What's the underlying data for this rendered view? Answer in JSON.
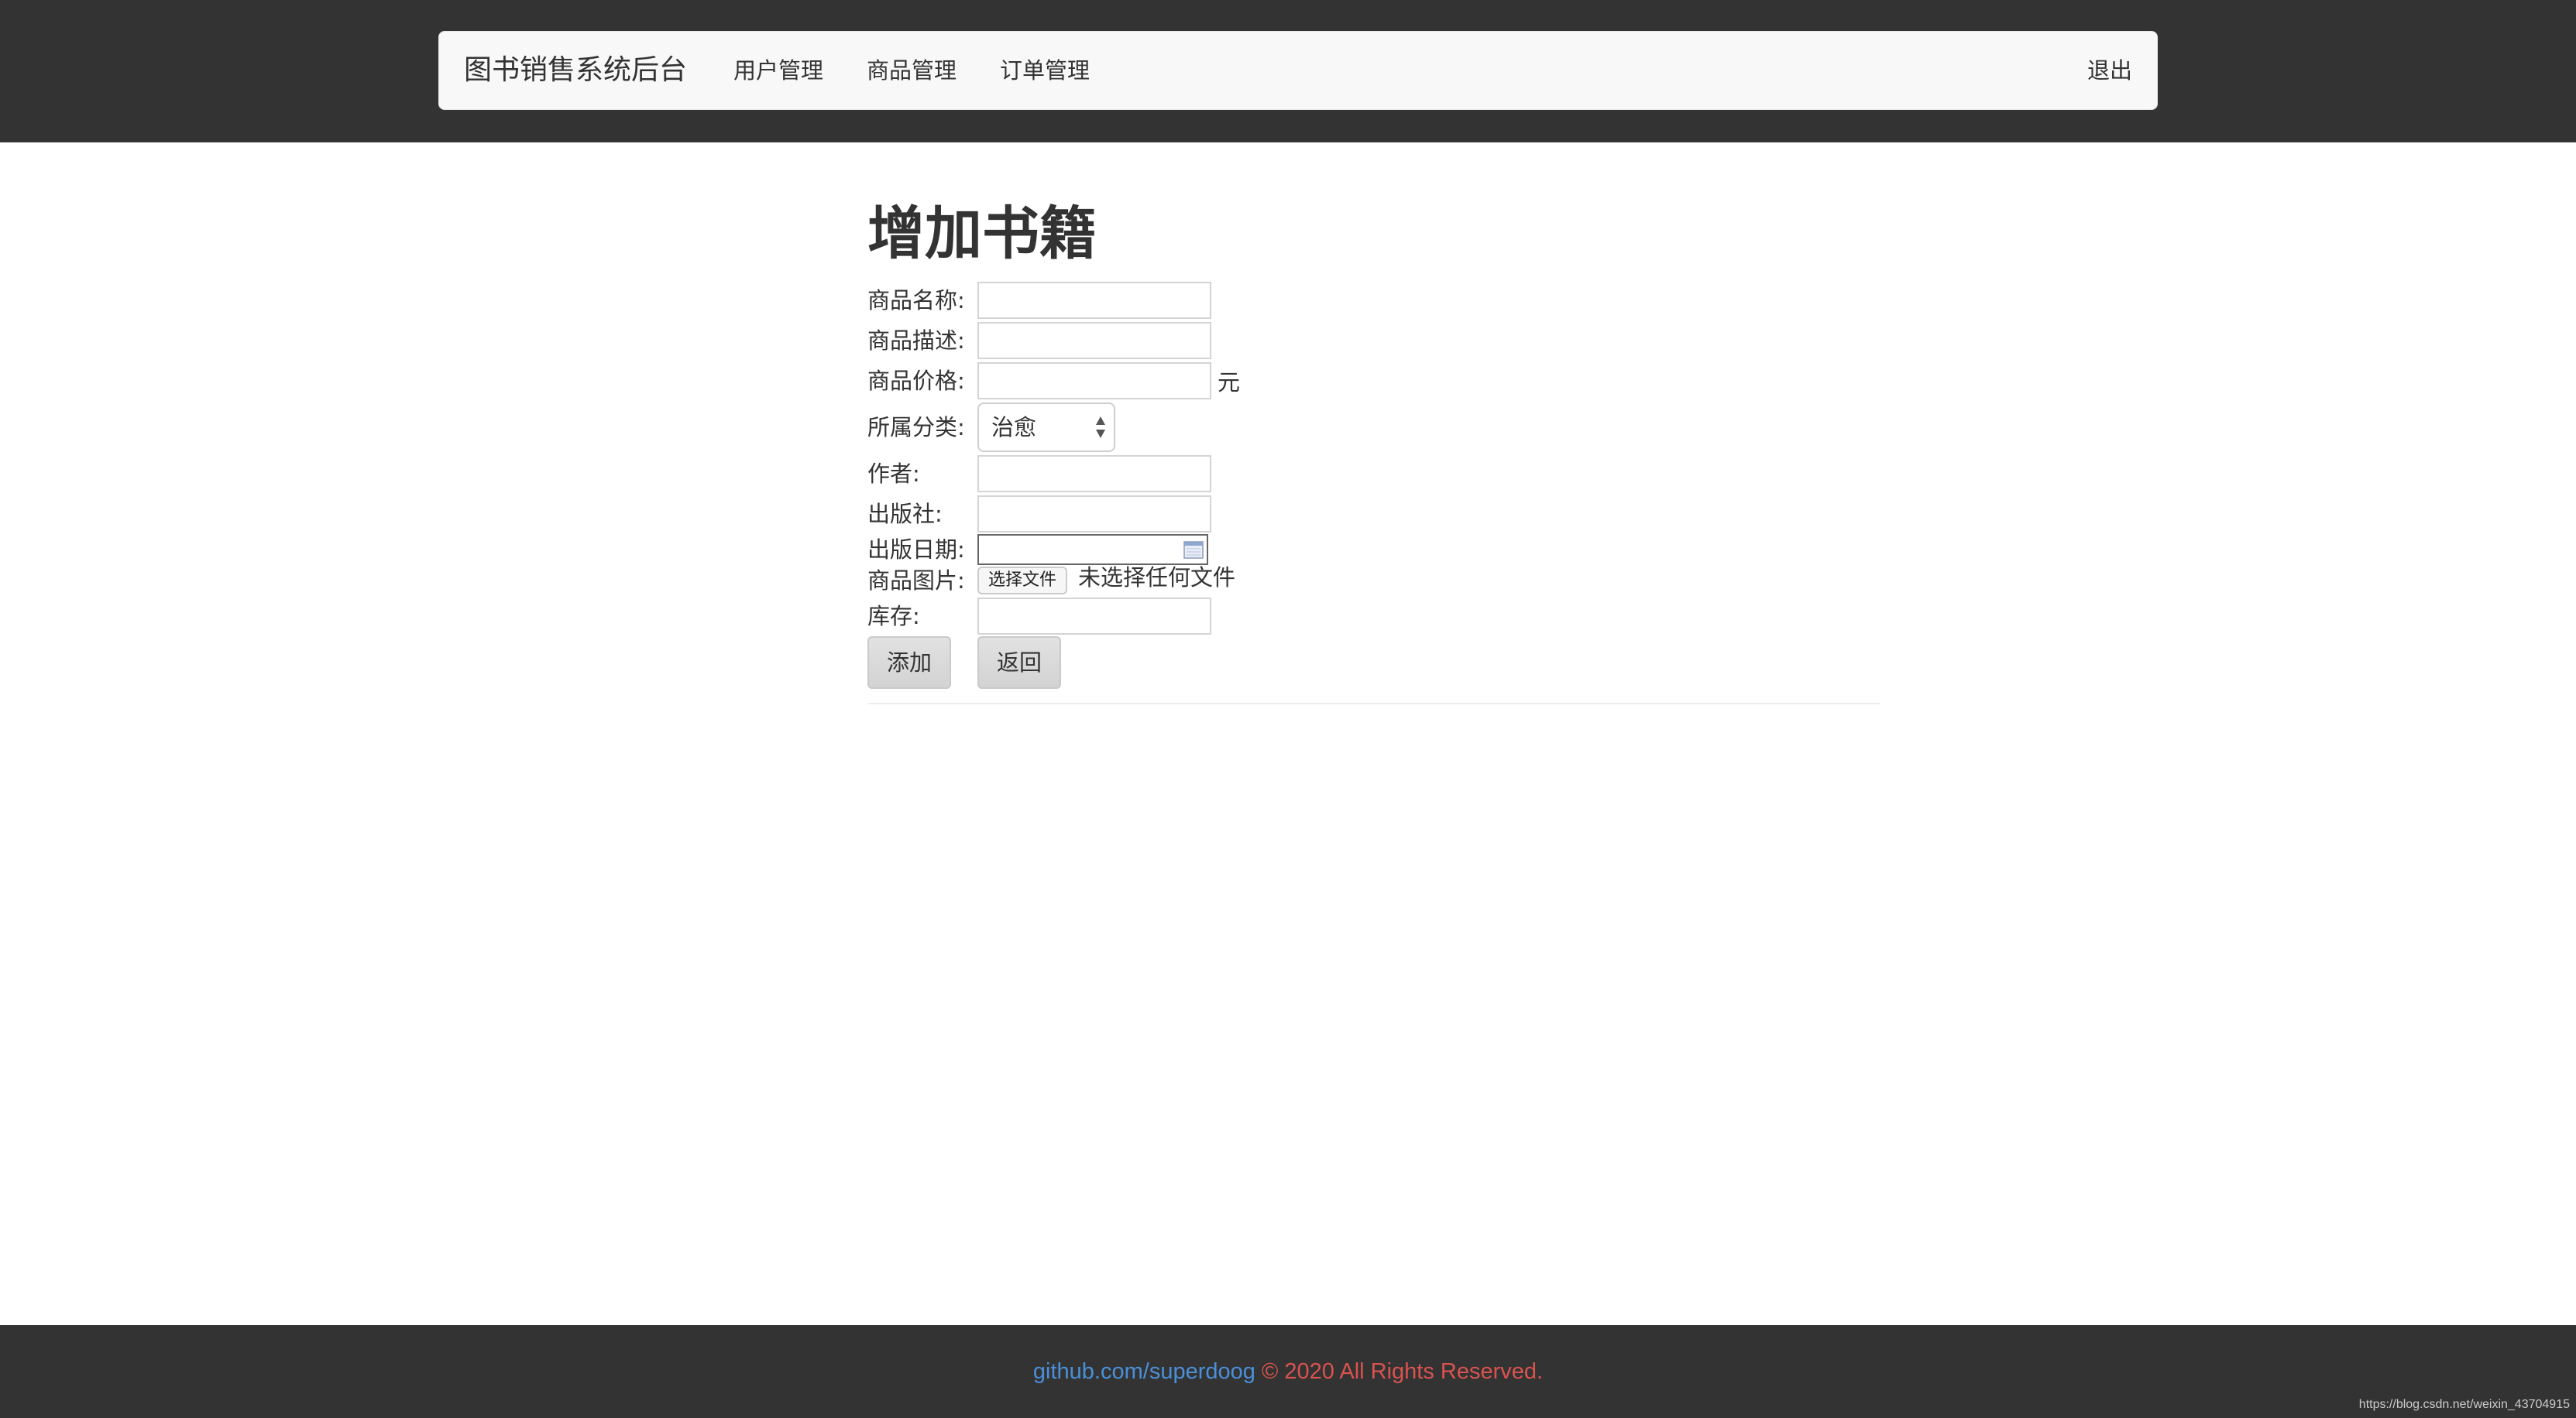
{
  "navbar": {
    "brand": "图书销售系统后台",
    "links": [
      "用户管理",
      "商品管理",
      "订单管理"
    ],
    "logout": "退出"
  },
  "form": {
    "title": "增加书籍",
    "name_label": "商品名称:",
    "description_label": "商品描述:",
    "price_label": "商品价格:",
    "price_unit": "元",
    "category_label": "所属分类:",
    "category_value": "治愈",
    "author_label": "作者:",
    "publisher_label": "出版社:",
    "publish_date_label": "出版日期:",
    "image_label": "商品图片:",
    "file_button": "选择文件",
    "file_status": "未选择任何文件",
    "stock_label": "库存:",
    "add_button": "添加",
    "back_button": "返回"
  },
  "footer": {
    "link": "github.com/superdoog",
    "copyright": " © 2020 All Rights Reserved.",
    "watermark": "https://blog.csdn.net/weixin_43704915"
  },
  "colors": {
    "header_bg": "#333333",
    "navbar_bg": "#f8f8f8",
    "footer_link": "#4a90d9",
    "footer_copyright": "#d9534f"
  }
}
